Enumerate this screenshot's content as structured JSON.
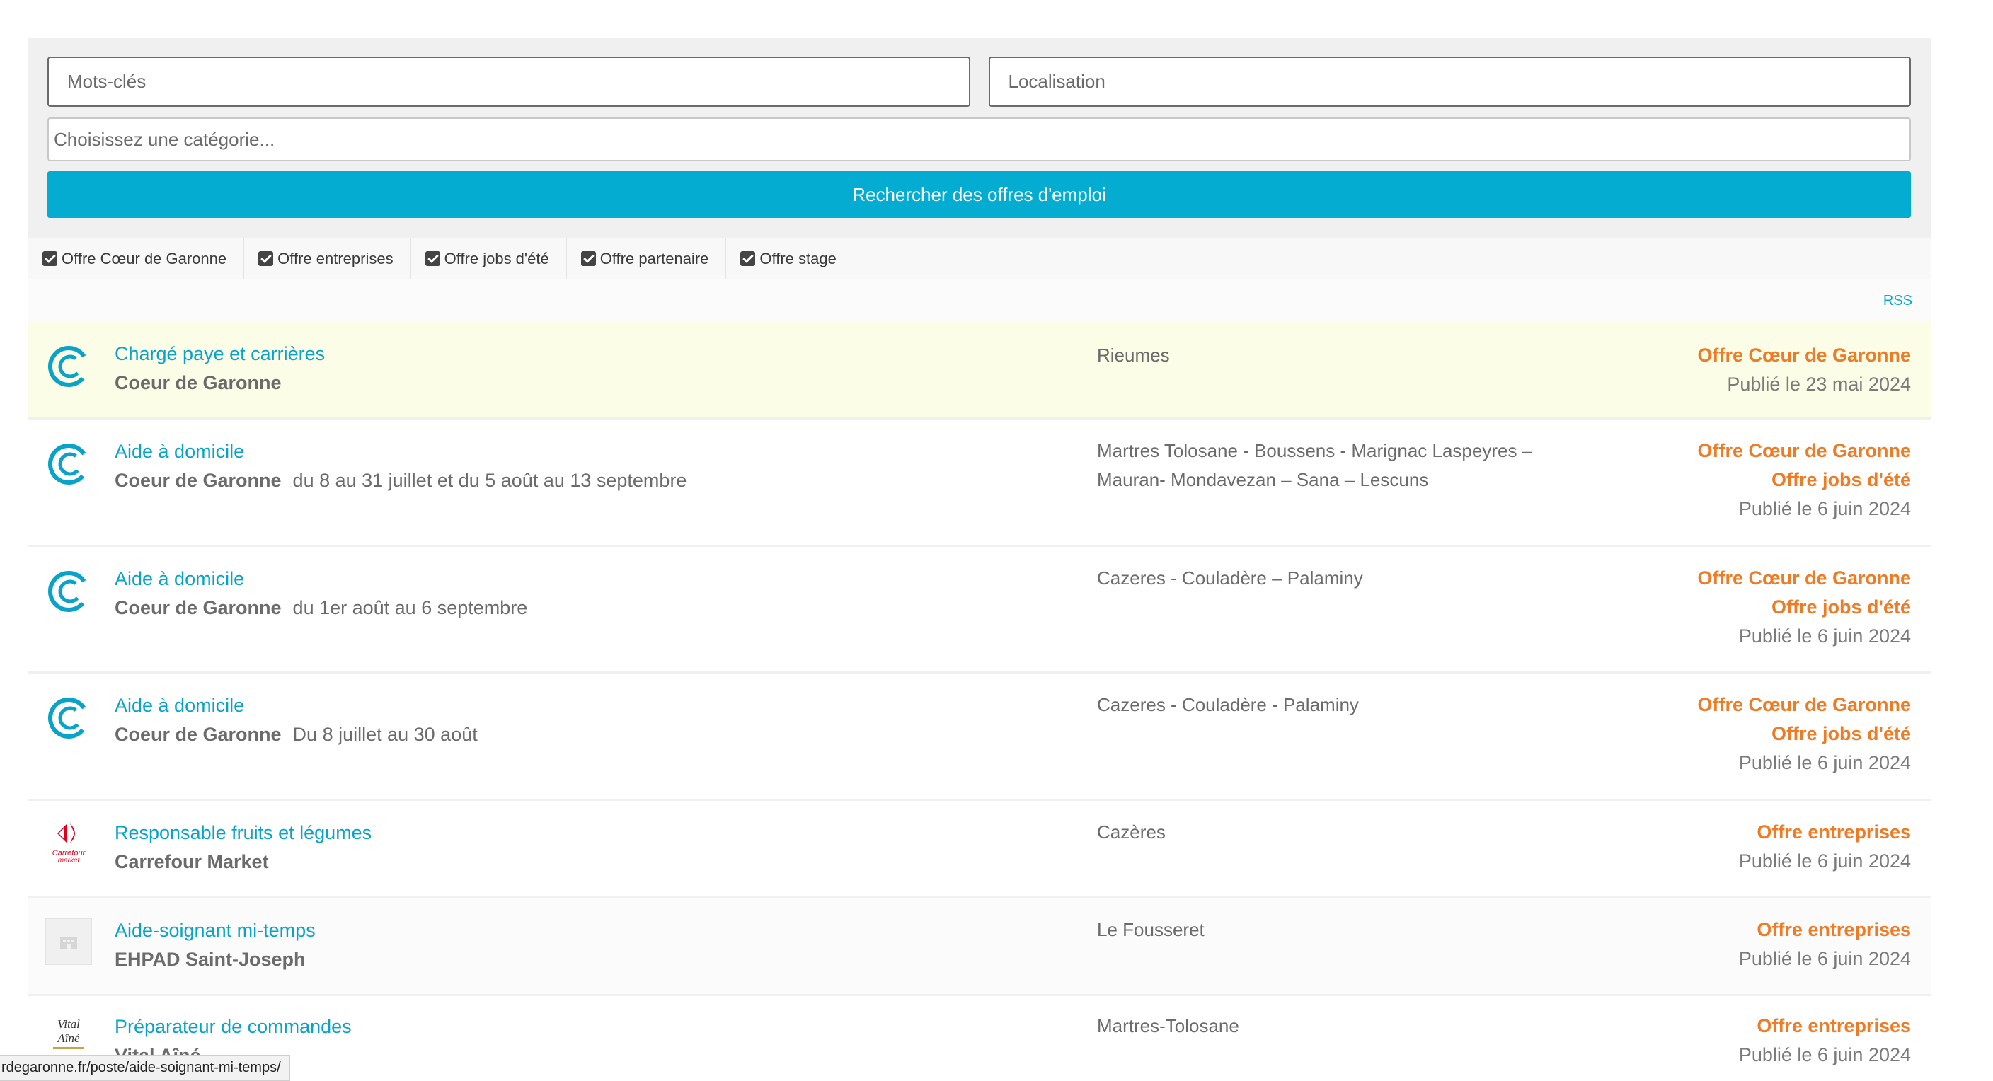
{
  "search": {
    "keywords_placeholder": "Mots-clés",
    "location_placeholder": "Localisation",
    "category_placeholder": "Choisissez une catégorie...",
    "button_label": "Rechercher des offres d'emploi"
  },
  "filters": [
    {
      "label": "Offre Cœur de Garonne",
      "checked": true
    },
    {
      "label": "Offre entreprises",
      "checked": true
    },
    {
      "label": "Offre jobs d'été",
      "checked": true
    },
    {
      "label": "Offre partenaire",
      "checked": true
    },
    {
      "label": "Offre stage",
      "checked": true
    }
  ],
  "rss_label": "RSS",
  "jobs": [
    {
      "title": "Chargé paye et carrières",
      "company": "Coeur de Garonne",
      "extra": "",
      "location": "Rieumes",
      "types": [
        "Offre Cœur de Garonne"
      ],
      "date": "Publié le 23 mai 2024",
      "logo": "coeur-de-garonne-logo"
    },
    {
      "title": "Aide à domicile",
      "company": "Coeur de Garonne",
      "extra": "du 8 au 31 juillet et du 5 août au 13 septembre",
      "location": "Martres Tolosane - Boussens - Marignac Laspeyres – Mauran- Mondavezan – Sana – Lescuns",
      "types": [
        "Offre Cœur de Garonne",
        "Offre jobs d'été"
      ],
      "date": "Publié le 6 juin 2024",
      "logo": "coeur-de-garonne-logo"
    },
    {
      "title": "Aide à domicile",
      "company": "Coeur de Garonne",
      "extra": "du 1er août au 6 septembre",
      "location": "Cazeres - Couladère – Palaminy",
      "types": [
        "Offre Cœur de Garonne",
        "Offre jobs d'été"
      ],
      "date": "Publié le 6 juin 2024",
      "logo": "coeur-de-garonne-logo"
    },
    {
      "title": "Aide à domicile",
      "company": "Coeur de Garonne",
      "extra": "Du 8 juillet au 30 août",
      "location": "Cazeres - Couladère - Palaminy",
      "types": [
        "Offre Cœur de Garonne",
        "Offre jobs d'été"
      ],
      "date": "Publié le 6 juin 2024",
      "logo": "coeur-de-garonne-logo"
    },
    {
      "title": "Responsable fruits et légumes",
      "company": "Carrefour Market",
      "extra": "",
      "location": "Cazères",
      "types": [
        "Offre entreprises"
      ],
      "date": "Publié le 6 juin 2024",
      "logo": "carrefour-market-logo"
    },
    {
      "title": "Aide-soignant mi-temps",
      "company": "EHPAD Saint-Joseph",
      "extra": "",
      "location": "Le Fousseret",
      "types": [
        "Offre entreprises"
      ],
      "date": "Publié le 6 juin 2024",
      "logo": "placeholder-logo"
    },
    {
      "title": "Préparateur de commandes",
      "company": "Vital Aîné",
      "extra": "",
      "location": "Martres-Tolosane",
      "types": [
        "Offre entreprises"
      ],
      "date": "Publié le 6 juin 2024",
      "logo": "vital-aine-logo"
    }
  ],
  "logo_text": {
    "carrefour": "Carrefour",
    "market": "market",
    "vital": "Vital Aîné"
  },
  "status_bar_url": "rdegaronne.fr/poste/aide-soignant-mi-temps/",
  "colors": {
    "accent": "#05acd2",
    "job_type": "#ee7b26",
    "featured_bg": "#fbfde6"
  }
}
